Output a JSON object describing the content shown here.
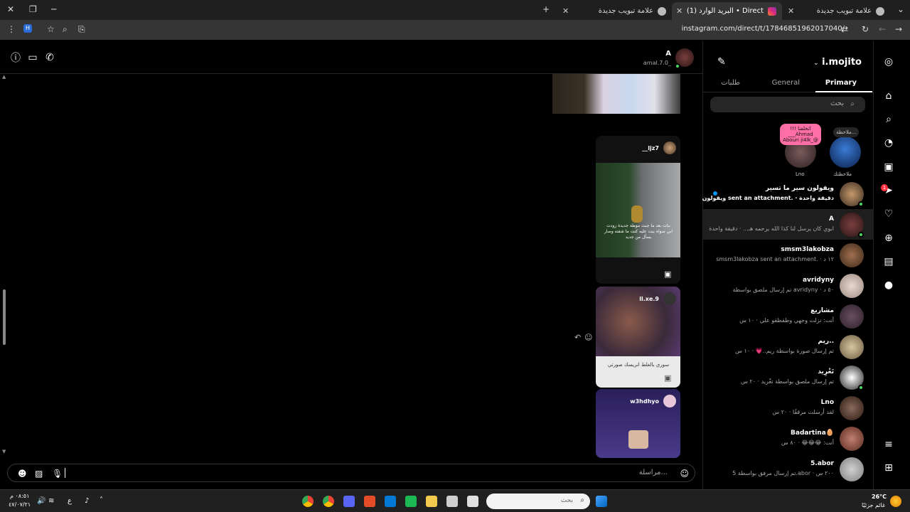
{
  "browser": {
    "tabs": [
      {
        "title": "علامة تبويب جديدة",
        "active": false
      },
      {
        "title": "(1) البريد الوارد • Direct",
        "active": true
      },
      {
        "title": "علامة تبويب جديدة",
        "active": false
      }
    ],
    "url": "instagram.com/direct/t/17846851962017040/"
  },
  "instagram": {
    "account": "i.mojito",
    "inbox_tabs": [
      "Primary",
      "General",
      "طلبات"
    ],
    "search_placeholder": "بحث",
    "nav_badges": {
      "messages": "1"
    },
    "notes": [
      {
        "name": "ملاحظتك",
        "bubble": "ملاحظة..."
      },
      {
        "name": "Lno",
        "bubble": "!!! اتخلفنا ___Ahmad Abouri ji4lk_@"
      }
    ],
    "conversations": [
      {
        "name": "ويقولون سير ما تسير",
        "preview": "ويقولون sent an attachment. · دقيقة واحدة",
        "online": true,
        "unread": true
      },
      {
        "name": "A",
        "preview": "ابوي كان يرسل لنا كذا الله يرحمه هـ... · دقيقة واحدة",
        "online": true,
        "selected": true
      },
      {
        "name": "smsm3lakobza",
        "preview": "smsm3lakobza sent an attachment. · ١٢ د"
      },
      {
        "name": "avridyny",
        "preview": "تم إرسال ملصق بواسطة avridyny · ٥٠ د"
      },
      {
        "name": "مشاريع",
        "preview": "أنت: نزلت وجهي وطقطقو علي · ١٠ س"
      },
      {
        "name": "ريم..",
        "preview": "تم إرسال صورة بواسطة ريم..💗 · ١٠ س"
      },
      {
        "name": "تَغْرِيد",
        "preview": "تم إرسال ملصق بواسطة تغْريد · ٢٠ س",
        "online": true
      },
      {
        "name": "Lno",
        "preview": "لقد أرسلت مرفقًا · ٢٠ س"
      },
      {
        "name": "Badartina🥚",
        "preview": "أنت: 😂😂😂 · ٨٠ س"
      },
      {
        "name": "5.abor",
        "preview": "تم إرسال مرفق بواسطة 5.abor · ٢٠٠ س"
      }
    ]
  },
  "chat": {
    "contact_name": "A",
    "contact_username": "amal.7.0_",
    "messages": [
      {
        "type": "reel",
        "author": "__ljz7",
        "caption": "بنات بعد ما جبت موطة جديدة زودت ابي سواه بيت عليه كنت ما شفته وصار يسأل من جديد"
      },
      {
        "type": "reel",
        "author": "ll.xe.9",
        "caption": "سوري بالغلط انريسك صورتي"
      },
      {
        "type": "reel",
        "author": "w3hdhyo",
        "caption": ""
      }
    ],
    "composer_placeholder": "مراسلة..."
  },
  "taskbar": {
    "time": "٠٨:٥١ م",
    "date": "٤٧/٠٧/٢١",
    "lang": "ع",
    "search_placeholder": "بحث",
    "weather_temp": "26°C",
    "weather_desc": "غائم جزئيًا"
  }
}
